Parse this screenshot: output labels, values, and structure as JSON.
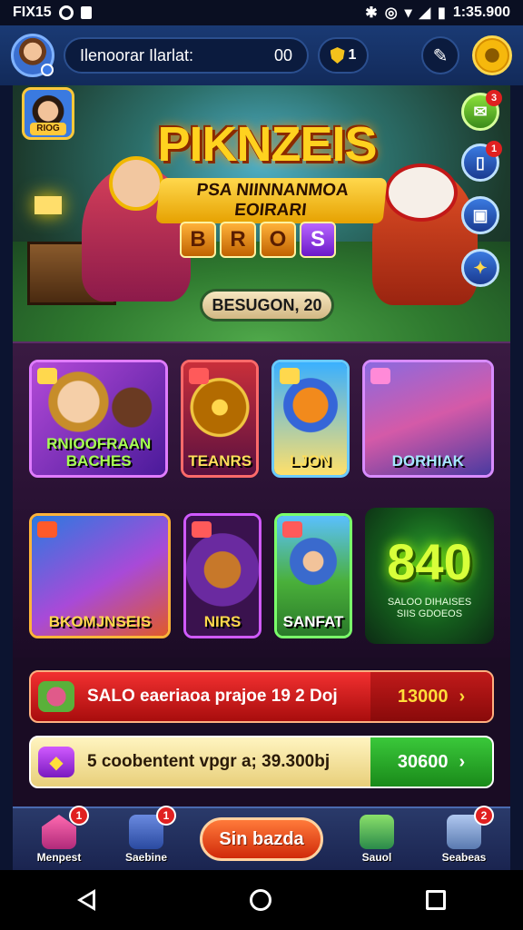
{
  "status_bar": {
    "left_text": "FIX15",
    "right_text": "1:35.900"
  },
  "top_bar": {
    "player_name": "Ilenoorar Ilarlat:",
    "score": "00",
    "shield_count": "1"
  },
  "hero": {
    "title": "PIKNZEIS",
    "subtitle": "PSA NIINNANMOA EOIRARI",
    "blocks": [
      "B",
      "R",
      "O",
      "S"
    ],
    "season_label": "BESUGON, 20",
    "profile_tag": "RIOG",
    "side_buttons": [
      {
        "badge": "3"
      },
      {
        "badge": "1"
      },
      {
        "badge": ""
      },
      {
        "badge": ""
      }
    ]
  },
  "cards_row1": [
    {
      "label": "RNIOOFRAAN BACHES"
    },
    {
      "label": "TEANRS"
    },
    {
      "label": "LJON"
    },
    {
      "label": "DORHIAK"
    }
  ],
  "cards_row2": [
    {
      "label": "BKOMJNSEIS"
    },
    {
      "label": "NIRS"
    },
    {
      "label": "SANFAT"
    }
  ],
  "big_score": {
    "value": "840",
    "caption_line1": "SALOO DIHAISES",
    "caption_line2": "SIIS GDOEOS"
  },
  "offers": [
    {
      "text": "SALO eaeriaoa prajoe 19 2 Doj",
      "price": "13000",
      "arrow": "›"
    },
    {
      "text": "5 coobentent vpgr a; 39.300bj",
      "price": "30600",
      "arrow": "›"
    }
  ],
  "bottom_nav": {
    "items": [
      {
        "label": "Menpest",
        "badge": "1"
      },
      {
        "label": "Saebine",
        "badge": "1"
      },
      {
        "label": "Sauol",
        "badge": ""
      },
      {
        "label": "Seabeas",
        "badge": "2"
      }
    ],
    "play_label": "Sin bazda"
  },
  "colors": {
    "accent": "#f6b80c",
    "offer_red": "#e02020",
    "offer_green": "#2aa82a"
  }
}
